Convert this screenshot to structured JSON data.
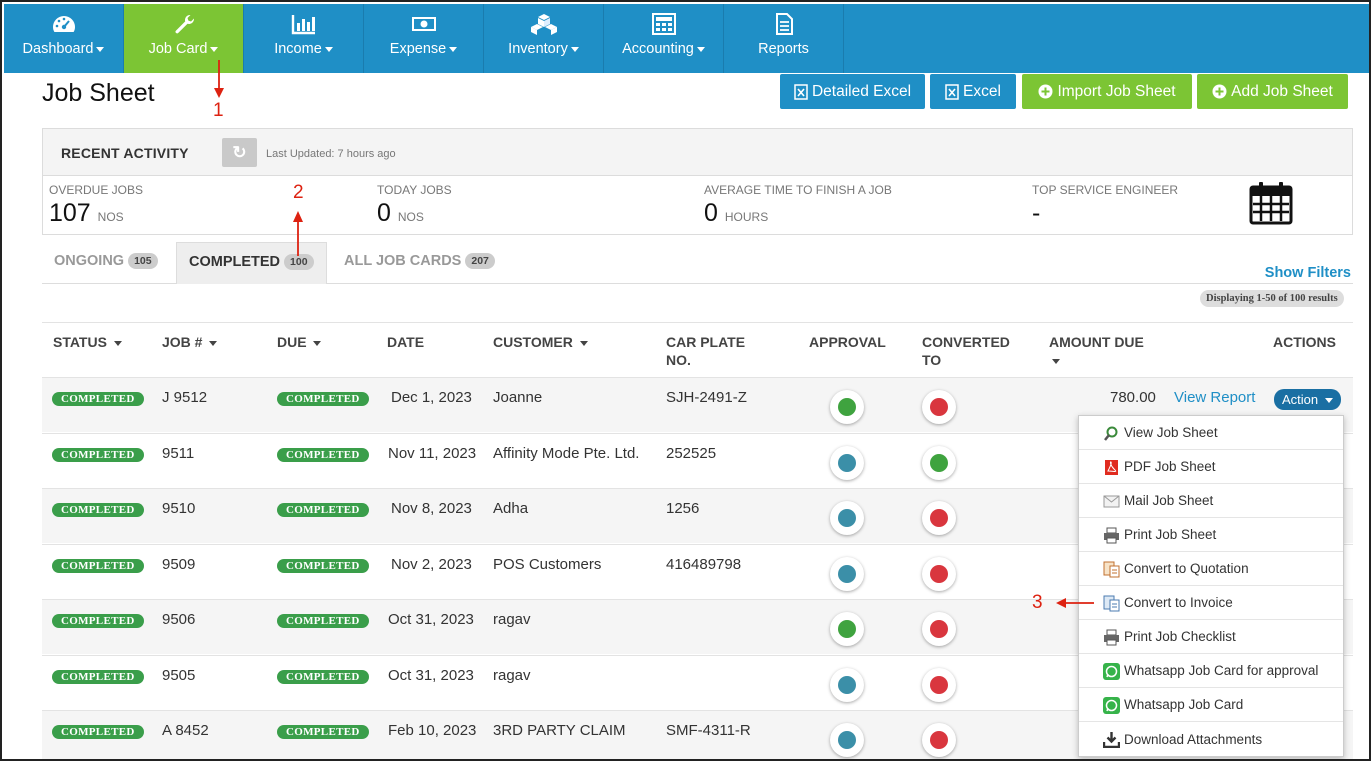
{
  "nav": [
    {
      "label": "Dashboard",
      "icon": "dashboard-icon",
      "caret": true,
      "active": false
    },
    {
      "label": "Job Card",
      "icon": "wrench-icon",
      "caret": true,
      "active": true
    },
    {
      "label": "Income",
      "icon": "bar-chart-icon",
      "caret": true,
      "active": false
    },
    {
      "label": "Expense",
      "icon": "banknote-icon",
      "caret": true,
      "active": false
    },
    {
      "label": "Inventory",
      "icon": "boxes-icon",
      "caret": true,
      "active": false
    },
    {
      "label": "Accounting",
      "icon": "calculator-icon",
      "caret": true,
      "active": false
    },
    {
      "label": "Reports",
      "icon": "document-icon",
      "caret": false,
      "active": false
    }
  ],
  "page": {
    "title": "Job Sheet",
    "buttons": {
      "detailed_excel": "Detailed Excel",
      "excel": "Excel",
      "import": "Import Job Sheet",
      "add": "Add Job Sheet"
    }
  },
  "activity": {
    "title": "RECENT ACTIVITY",
    "updated": "Last Updated: 7 hours ago",
    "stats": [
      {
        "label": "OVERDUE JOBS",
        "value": "107",
        "unit": "NOS"
      },
      {
        "label": "TODAY JOBS",
        "value": "0",
        "unit": "NOS"
      },
      {
        "label": "AVERAGE TIME TO FINISH A JOB",
        "value": "0",
        "unit": "HOURS"
      },
      {
        "label": "TOP SERVICE ENGINEER",
        "value": "-",
        "unit": ""
      }
    ]
  },
  "tabs": [
    {
      "label": "ONGOING",
      "count": "105"
    },
    {
      "label": "COMPLETED",
      "count": "100"
    },
    {
      "label": "ALL JOB CARDS",
      "count": "207"
    }
  ],
  "show_filters": "Show Filters",
  "displaying": "Displaying 1-50 of 100 results",
  "table": {
    "headers": {
      "status": "STATUS",
      "job": "JOB #",
      "due": "DUE",
      "date": "DATE",
      "customer": "CUSTOMER",
      "car_plate_1": "CAR PLATE",
      "car_plate_2": "NO.",
      "approval": "APPROVAL",
      "converted_1": "CONVERTED",
      "converted_2": "TO",
      "amount_due": "AMOUNT DUE",
      "actions": "ACTIONS"
    },
    "rows": [
      {
        "status": "COMPLETED",
        "job": "J 9512",
        "due": "COMPLETED",
        "date": "Dec 1, 2023",
        "customer": "Joanne",
        "plate": "SJH-2491-Z",
        "approval": "green",
        "converted": "red",
        "amount": "780.00",
        "view": "View Report",
        "action": "Action"
      },
      {
        "status": "COMPLETED",
        "job": "9511",
        "due": "COMPLETED",
        "date": "Nov 11, 2023",
        "customer": "Affinity Mode Pte. Ltd.",
        "plate": "252525",
        "approval": "teal",
        "converted": "green",
        "amount": "",
        "view": "",
        "action": ""
      },
      {
        "status": "COMPLETED",
        "job": "9510",
        "due": "COMPLETED",
        "date": "Nov 8, 2023",
        "customer": "Adha",
        "plate": "1256",
        "approval": "teal",
        "converted": "red",
        "amount": "",
        "view": "",
        "action": ""
      },
      {
        "status": "COMPLETED",
        "job": "9509",
        "due": "COMPLETED",
        "date": "Nov 2, 2023",
        "customer": "POS Customers",
        "plate": "416489798",
        "approval": "teal",
        "converted": "red",
        "amount": "",
        "view": "",
        "action": ""
      },
      {
        "status": "COMPLETED",
        "job": "9506",
        "due": "COMPLETED",
        "date": "Oct 31, 2023",
        "customer": "ragav",
        "plate": "",
        "approval": "green",
        "converted": "red",
        "amount": "",
        "view": "",
        "action": ""
      },
      {
        "status": "COMPLETED",
        "job": "9505",
        "due": "COMPLETED",
        "date": "Oct 31, 2023",
        "customer": "ragav",
        "plate": "",
        "approval": "teal",
        "converted": "red",
        "amount": "",
        "view": "",
        "action": ""
      },
      {
        "status": "COMPLETED",
        "job": "A 8452",
        "due": "COMPLETED",
        "date": "Feb 10, 2023",
        "customer": "3RD PARTY CLAIM",
        "plate": "SMF-4311-R",
        "approval": "teal",
        "converted": "red",
        "amount": "",
        "view": "",
        "action": ""
      }
    ]
  },
  "dropdown": [
    {
      "label": "View Job Sheet",
      "icon": "magnifier-icon"
    },
    {
      "label": "PDF Job Sheet",
      "icon": "pdf-icon"
    },
    {
      "label": "Mail Job Sheet",
      "icon": "envelope-icon"
    },
    {
      "label": "Print Job Sheet",
      "icon": "printer-icon"
    },
    {
      "label": "Convert to Quotation",
      "icon": "quotation-icon"
    },
    {
      "label": "Convert to Invoice",
      "icon": "invoice-icon"
    },
    {
      "label": "Print Job Checklist",
      "icon": "printer-icon"
    },
    {
      "label": "Whatsapp Job Card for approval",
      "icon": "whatsapp-icon"
    },
    {
      "label": "Whatsapp Job Card",
      "icon": "whatsapp-icon"
    },
    {
      "label": "Download Attachments",
      "icon": "download-icon"
    }
  ],
  "annotations": [
    "1",
    "2",
    "3"
  ],
  "colors": {
    "nav_blue": "#1f8fc6",
    "nav_active": "#7cc534",
    "status_green": "#3a9e4a",
    "dot_green": "#3fa33f",
    "dot_teal": "#3b8fa8",
    "dot_red": "#d9363e"
  }
}
